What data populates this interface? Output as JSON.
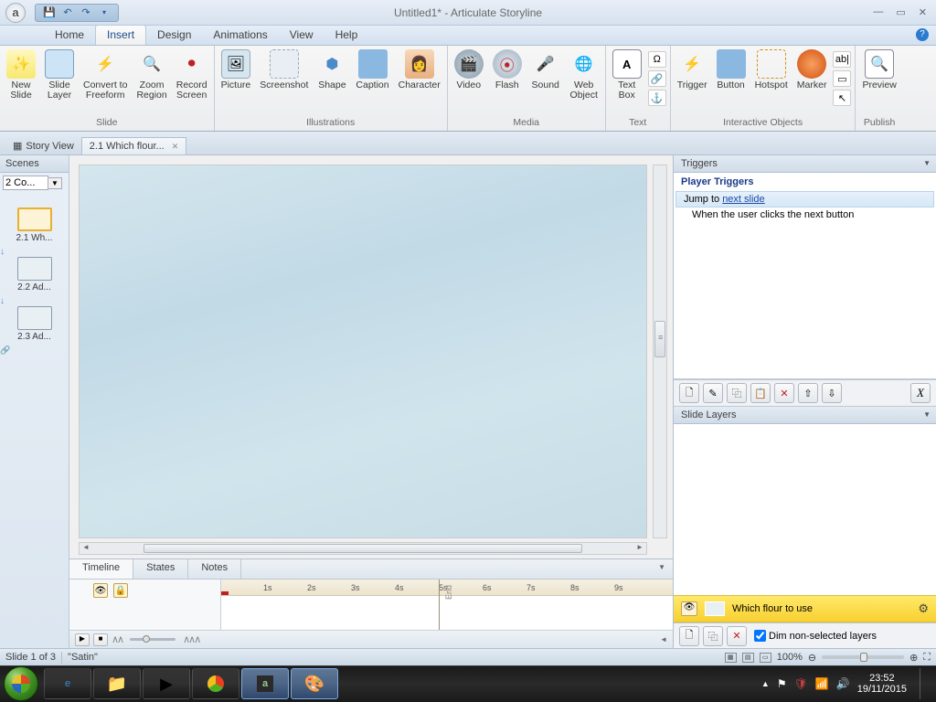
{
  "title": "Untitled1* -  Articulate Storyline",
  "menu": {
    "home": "Home",
    "insert": "Insert",
    "design": "Design",
    "animations": "Animations",
    "view": "View",
    "help": "Help"
  },
  "ribbon": {
    "slide": {
      "label": "Slide",
      "new_slide": "New\nSlide",
      "slide_layer": "Slide\nLayer",
      "convert": "Convert to\nFreeform",
      "zoom": "Zoom\nRegion",
      "record": "Record\nScreen"
    },
    "illus": {
      "label": "Illustrations",
      "picture": "Picture",
      "screenshot": "Screenshot",
      "shape": "Shape",
      "caption": "Caption",
      "character": "Character"
    },
    "media": {
      "label": "Media",
      "video": "Video",
      "flash": "Flash",
      "sound": "Sound",
      "web": "Web\nObject"
    },
    "text": {
      "label": "Text",
      "textbox": "Text\nBox",
      "symbol": "Ω",
      "ref": "🔗",
      "hyp": "⚓"
    },
    "inter": {
      "label": "Interactive Objects",
      "trigger": "Trigger",
      "button": "Button",
      "hotspot": "Hotspot",
      "marker": "Marker"
    },
    "publish": {
      "label": "Publish",
      "preview": "Preview"
    }
  },
  "tabs": {
    "story_view": "Story View",
    "slide_tab": "2.1 Which flour..."
  },
  "scenes": {
    "header": "Scenes",
    "selector": "2 Co...",
    "items": [
      {
        "label": "2.1  Wh..."
      },
      {
        "label": "2.2  Ad..."
      },
      {
        "label": "2.3  Ad..."
      }
    ]
  },
  "timeline": {
    "tabs": {
      "timeline": "Timeline",
      "states": "States",
      "notes": "Notes"
    },
    "ticks": [
      "1s",
      "2s",
      "3s",
      "4s",
      "5s",
      "6s",
      "7s",
      "8s",
      "9s"
    ],
    "end": "End"
  },
  "triggers": {
    "header": "Triggers",
    "player_triggers": "Player Triggers",
    "jump_prefix": "Jump to ",
    "jump_link": "next slide",
    "when": "When the user clicks the next button",
    "var_btn": "X"
  },
  "layers": {
    "header": "Slide Layers",
    "base_name": "Which flour to use",
    "dim_label": "Dim non-selected layers"
  },
  "status": {
    "slide": "Slide 1 of 3",
    "theme": "\"Satin\"",
    "zoom": "100%"
  },
  "taskbar": {
    "time": "23:52",
    "date": "19/11/2015"
  }
}
